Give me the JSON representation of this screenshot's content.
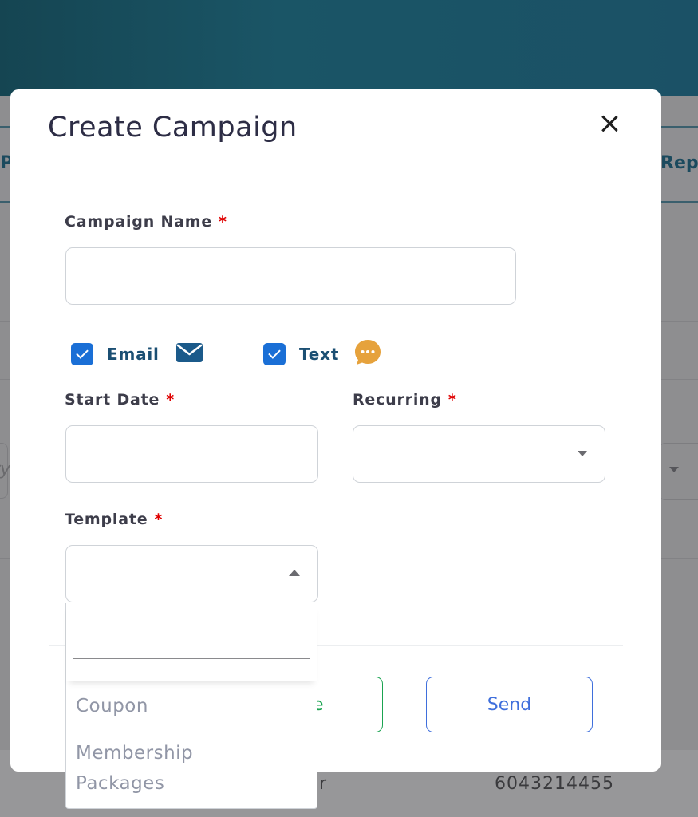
{
  "background": {
    "tab_left_fragment": "P",
    "tab_right_fragment": "Rep",
    "input_fragment": "ry",
    "table_row_fragment": "r",
    "phone": "6043214455"
  },
  "modal": {
    "title": "Create Campaign",
    "campaign_name": {
      "label": "Campaign Name",
      "required": "*",
      "value": ""
    },
    "channels": [
      {
        "label": "Email",
        "checked": true,
        "icon": "mail-icon",
        "icon_color": "#1b5a8a"
      },
      {
        "label": "Text",
        "checked": true,
        "icon": "chat-bubble-icon",
        "icon_color": "#e6a23c"
      }
    ],
    "start_date": {
      "label": "Start Date",
      "required": "*",
      "value": ""
    },
    "recurring": {
      "label": "Recurring",
      "required": "*",
      "value": ""
    },
    "template": {
      "label": "Template",
      "required": "*",
      "value": "",
      "search_value": "",
      "options": [
        "Coupon",
        "Membership Packages"
      ]
    },
    "buttons": {
      "save_fragment": "ve",
      "send": "Send"
    }
  },
  "colors": {
    "checkbox": "#1a6fd6",
    "required": "#e00000",
    "save": "#1aa350",
    "send": "#3f6fdc",
    "header": "#1a5566"
  }
}
